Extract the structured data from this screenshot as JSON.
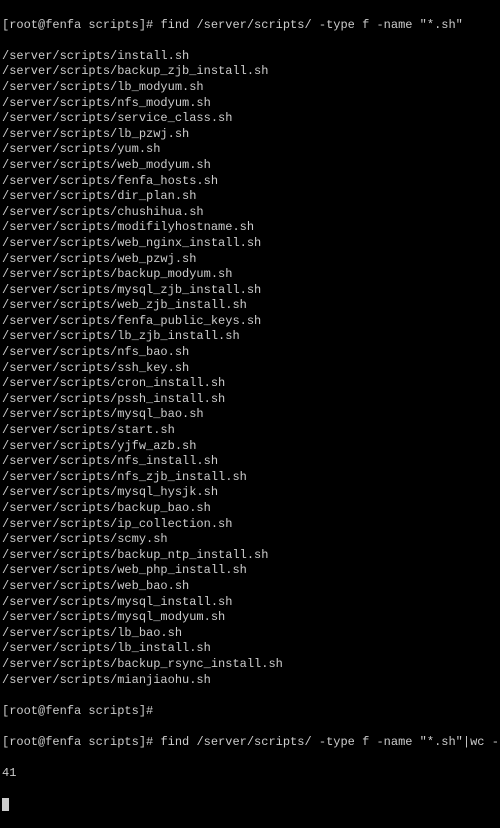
{
  "prompt1": "[root@fenfa scripts]# ",
  "command1": "find /server/scripts/ -type f -name \"*.sh\"",
  "files": [
    "/server/scripts/install.sh",
    "/server/scripts/backup_zjb_install.sh",
    "/server/scripts/lb_modyum.sh",
    "/server/scripts/nfs_modyum.sh",
    "/server/scripts/service_class.sh",
    "/server/scripts/lb_pzwj.sh",
    "/server/scripts/yum.sh",
    "/server/scripts/web_modyum.sh",
    "/server/scripts/fenfa_hosts.sh",
    "/server/scripts/dir_plan.sh",
    "/server/scripts/chushihua.sh",
    "/server/scripts/modifilyhostname.sh",
    "/server/scripts/web_nginx_install.sh",
    "/server/scripts/web_pzwj.sh",
    "/server/scripts/backup_modyum.sh",
    "/server/scripts/mysql_zjb_install.sh",
    "/server/scripts/web_zjb_install.sh",
    "/server/scripts/fenfa_public_keys.sh",
    "/server/scripts/lb_zjb_install.sh",
    "/server/scripts/nfs_bao.sh",
    "/server/scripts/ssh_key.sh",
    "/server/scripts/cron_install.sh",
    "/server/scripts/pssh_install.sh",
    "/server/scripts/mysql_bao.sh",
    "/server/scripts/start.sh",
    "/server/scripts/yjfw_azb.sh",
    "/server/scripts/nfs_install.sh",
    "/server/scripts/nfs_zjb_install.sh",
    "/server/scripts/mysql_hysjk.sh",
    "/server/scripts/backup_bao.sh",
    "/server/scripts/ip_collection.sh",
    "/server/scripts/scmy.sh",
    "/server/scripts/backup_ntp_install.sh",
    "/server/scripts/web_php_install.sh",
    "/server/scripts/web_bao.sh",
    "/server/scripts/mysql_install.sh",
    "/server/scripts/mysql_modyum.sh",
    "/server/scripts/lb_bao.sh",
    "/server/scripts/lb_install.sh",
    "/server/scripts/backup_rsync_install.sh",
    "/server/scripts/mianjiaohu.sh"
  ],
  "prompt2": "[root@fenfa scripts]#",
  "prompt3": "[root@fenfa scripts]# ",
  "command2": "find /server/scripts/ -type f -name \"*.sh\"|wc -l",
  "result": "41"
}
